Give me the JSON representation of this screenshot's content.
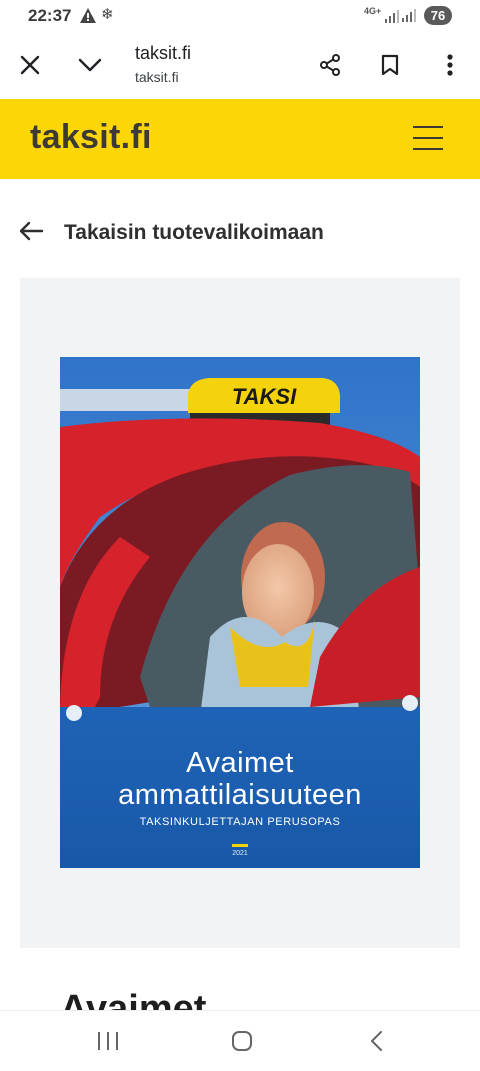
{
  "status_bar": {
    "time": "22:37",
    "network": "4G+",
    "battery": "76",
    "icons": [
      "warning-icon",
      "snowflake-icon",
      "signal-icon",
      "battery-icon"
    ]
  },
  "browser": {
    "page_title": "taksit.fi",
    "url": "taksit.fi",
    "icons": [
      "close-icon",
      "chevron-down-icon",
      "share-icon",
      "bookmark-icon",
      "more-vert-icon"
    ]
  },
  "site": {
    "logo": "taksit.fi",
    "brand_color": "#fcd606",
    "menu_icon": "hamburger-menu-icon"
  },
  "back_link": {
    "label": "Takaisin tuotevalikoimaan",
    "icon": "arrow-left-icon"
  },
  "product": {
    "cover": {
      "roof_sign": "TAKSI",
      "title_line1": "Avaimet",
      "title_line2": "ammattilaisuuteen",
      "subtitle": "TAKSINKULJETTAJAN PERUSOPAS",
      "year": "2021"
    },
    "heading": "Avaimet"
  },
  "nav_bar": {
    "icons": [
      "recents-icon",
      "home-icon",
      "back-icon"
    ]
  }
}
